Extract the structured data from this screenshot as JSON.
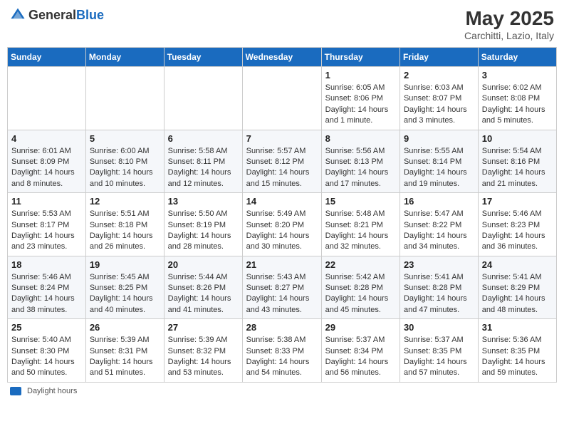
{
  "header": {
    "logo_general": "General",
    "logo_blue": "Blue",
    "title": "May 2025",
    "location": "Carchitti, Lazio, Italy"
  },
  "days_of_week": [
    "Sunday",
    "Monday",
    "Tuesday",
    "Wednesday",
    "Thursday",
    "Friday",
    "Saturday"
  ],
  "weeks": [
    [
      {
        "day": "",
        "info": ""
      },
      {
        "day": "",
        "info": ""
      },
      {
        "day": "",
        "info": ""
      },
      {
        "day": "",
        "info": ""
      },
      {
        "day": "1",
        "info": "Sunrise: 6:05 AM\nSunset: 8:06 PM\nDaylight: 14 hours and 1 minute."
      },
      {
        "day": "2",
        "info": "Sunrise: 6:03 AM\nSunset: 8:07 PM\nDaylight: 14 hours and 3 minutes."
      },
      {
        "day": "3",
        "info": "Sunrise: 6:02 AM\nSunset: 8:08 PM\nDaylight: 14 hours and 5 minutes."
      }
    ],
    [
      {
        "day": "4",
        "info": "Sunrise: 6:01 AM\nSunset: 8:09 PM\nDaylight: 14 hours and 8 minutes."
      },
      {
        "day": "5",
        "info": "Sunrise: 6:00 AM\nSunset: 8:10 PM\nDaylight: 14 hours and 10 minutes."
      },
      {
        "day": "6",
        "info": "Sunrise: 5:58 AM\nSunset: 8:11 PM\nDaylight: 14 hours and 12 minutes."
      },
      {
        "day": "7",
        "info": "Sunrise: 5:57 AM\nSunset: 8:12 PM\nDaylight: 14 hours and 15 minutes."
      },
      {
        "day": "8",
        "info": "Sunrise: 5:56 AM\nSunset: 8:13 PM\nDaylight: 14 hours and 17 minutes."
      },
      {
        "day": "9",
        "info": "Sunrise: 5:55 AM\nSunset: 8:14 PM\nDaylight: 14 hours and 19 minutes."
      },
      {
        "day": "10",
        "info": "Sunrise: 5:54 AM\nSunset: 8:16 PM\nDaylight: 14 hours and 21 minutes."
      }
    ],
    [
      {
        "day": "11",
        "info": "Sunrise: 5:53 AM\nSunset: 8:17 PM\nDaylight: 14 hours and 23 minutes."
      },
      {
        "day": "12",
        "info": "Sunrise: 5:51 AM\nSunset: 8:18 PM\nDaylight: 14 hours and 26 minutes."
      },
      {
        "day": "13",
        "info": "Sunrise: 5:50 AM\nSunset: 8:19 PM\nDaylight: 14 hours and 28 minutes."
      },
      {
        "day": "14",
        "info": "Sunrise: 5:49 AM\nSunset: 8:20 PM\nDaylight: 14 hours and 30 minutes."
      },
      {
        "day": "15",
        "info": "Sunrise: 5:48 AM\nSunset: 8:21 PM\nDaylight: 14 hours and 32 minutes."
      },
      {
        "day": "16",
        "info": "Sunrise: 5:47 AM\nSunset: 8:22 PM\nDaylight: 14 hours and 34 minutes."
      },
      {
        "day": "17",
        "info": "Sunrise: 5:46 AM\nSunset: 8:23 PM\nDaylight: 14 hours and 36 minutes."
      }
    ],
    [
      {
        "day": "18",
        "info": "Sunrise: 5:46 AM\nSunset: 8:24 PM\nDaylight: 14 hours and 38 minutes."
      },
      {
        "day": "19",
        "info": "Sunrise: 5:45 AM\nSunset: 8:25 PM\nDaylight: 14 hours and 40 minutes."
      },
      {
        "day": "20",
        "info": "Sunrise: 5:44 AM\nSunset: 8:26 PM\nDaylight: 14 hours and 41 minutes."
      },
      {
        "day": "21",
        "info": "Sunrise: 5:43 AM\nSunset: 8:27 PM\nDaylight: 14 hours and 43 minutes."
      },
      {
        "day": "22",
        "info": "Sunrise: 5:42 AM\nSunset: 8:28 PM\nDaylight: 14 hours and 45 minutes."
      },
      {
        "day": "23",
        "info": "Sunrise: 5:41 AM\nSunset: 8:28 PM\nDaylight: 14 hours and 47 minutes."
      },
      {
        "day": "24",
        "info": "Sunrise: 5:41 AM\nSunset: 8:29 PM\nDaylight: 14 hours and 48 minutes."
      }
    ],
    [
      {
        "day": "25",
        "info": "Sunrise: 5:40 AM\nSunset: 8:30 PM\nDaylight: 14 hours and 50 minutes."
      },
      {
        "day": "26",
        "info": "Sunrise: 5:39 AM\nSunset: 8:31 PM\nDaylight: 14 hours and 51 minutes."
      },
      {
        "day": "27",
        "info": "Sunrise: 5:39 AM\nSunset: 8:32 PM\nDaylight: 14 hours and 53 minutes."
      },
      {
        "day": "28",
        "info": "Sunrise: 5:38 AM\nSunset: 8:33 PM\nDaylight: 14 hours and 54 minutes."
      },
      {
        "day": "29",
        "info": "Sunrise: 5:37 AM\nSunset: 8:34 PM\nDaylight: 14 hours and 56 minutes."
      },
      {
        "day": "30",
        "info": "Sunrise: 5:37 AM\nSunset: 8:35 PM\nDaylight: 14 hours and 57 minutes."
      },
      {
        "day": "31",
        "info": "Sunrise: 5:36 AM\nSunset: 8:35 PM\nDaylight: 14 hours and 59 minutes."
      }
    ]
  ],
  "legend": {
    "color_label": "Daylight hours"
  }
}
